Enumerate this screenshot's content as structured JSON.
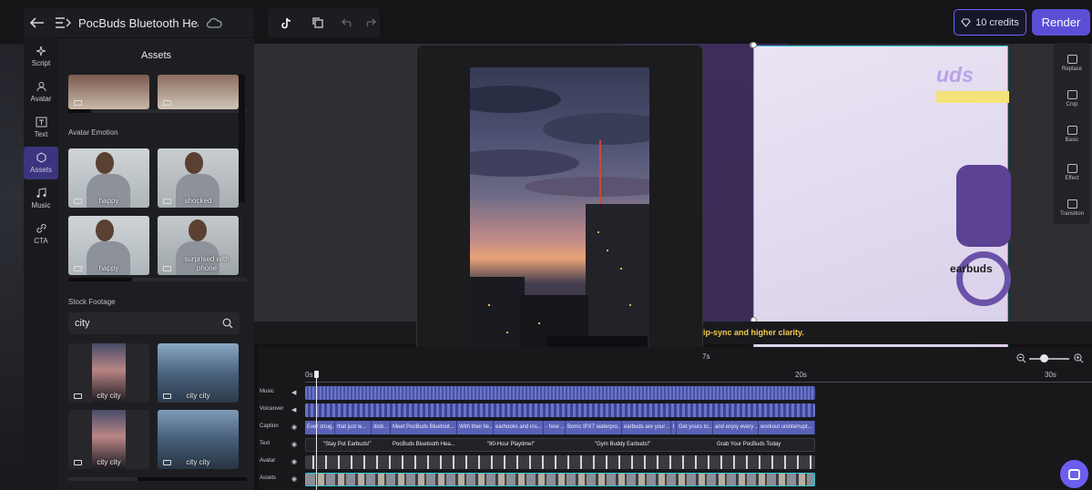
{
  "topbar": {
    "project_title": "PocBuds Bluetooth Headp...",
    "credits_label": "10 credits",
    "render_label": "Render"
  },
  "rail": {
    "items": [
      {
        "label": "Script",
        "icon": "sparkle-icon"
      },
      {
        "label": "Avatar",
        "icon": "avatar-icon"
      },
      {
        "label": "Text",
        "icon": "text-icon"
      },
      {
        "label": "Assets",
        "icon": "assets-icon"
      },
      {
        "label": "Music",
        "icon": "music-icon"
      },
      {
        "label": "CTA",
        "icon": "link-icon"
      }
    ]
  },
  "assets": {
    "title": "Assets",
    "avatar_emotion_label": "Avatar Emotion",
    "emotions": [
      "happy",
      "shocked",
      "happy",
      "surprised with phone"
    ],
    "stock_footage_label": "Stock Footage",
    "search_value": "city",
    "footage": [
      "city city",
      "city city",
      "city city",
      "city city"
    ]
  },
  "stage": {
    "promo_header": "uds",
    "promo_earbuds": "earbuds",
    "subtitle_partial": "ip-sync and higher clarity."
  },
  "tools": [
    {
      "label": "Replace"
    },
    {
      "label": "Crop"
    },
    {
      "label": "Basic"
    },
    {
      "label": "Effect"
    },
    {
      "label": "Transition"
    }
  ],
  "timeline": {
    "ticks": [
      "0s",
      "7s",
      "20s",
      "30s"
    ],
    "tracks": {
      "music": "Music",
      "voiceover": "Voiceover",
      "caption": "Caption",
      "text": "Text",
      "avatar": "Avatar",
      "assets": "Assets"
    },
    "captions": [
      "Ever strug...",
      "that just w...",
      "distr...",
      "Meet PocBuds Bluetoot...",
      "With their lle...",
      "earhooks and ins...",
      "- how ...",
      "Bomc IPX7 waterpro...",
      "earbuds are your ...",
      "l",
      "Get yours to...",
      "and enjoy every ...",
      "workout uninterrupt..."
    ],
    "texts": [
      "\"Stay Put Earbuds!\"",
      "PocBuds Bluetooth Hea...",
      "\"80-Hour Playtime!\"",
      "\"Gym Buddy Earbuds!\"",
      "Grab Your PocBuds Today"
    ]
  }
}
